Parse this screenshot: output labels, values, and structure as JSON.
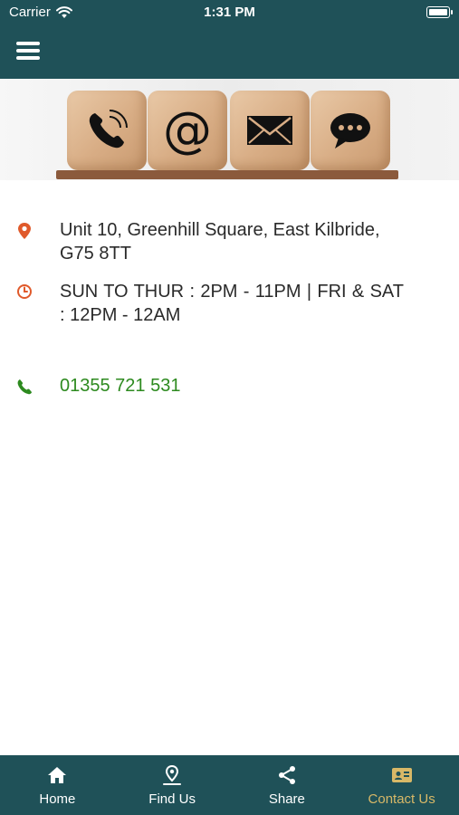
{
  "status_bar": {
    "carrier": "Carrier",
    "time": "1:31 PM",
    "battery_level": 1.0
  },
  "header": {
    "menu_icon": "hamburger-menu-icon",
    "background_color": "#1f5158"
  },
  "banner": {
    "cube_icons": [
      "phone-icon",
      "at-sign-icon",
      "envelope-icon",
      "chat-bubble-icon"
    ]
  },
  "contact": {
    "address": "Unit 10, Greenhill Square, East Kilbride, G75 8TT",
    "address_icon": "map-pin-icon",
    "hours": "SUN TO THUR : 2PM - 11PM | FRI & SAT : 12PM - 12AM",
    "hours_icon": "clock-icon",
    "phone": "01355 721 531",
    "phone_icon": "phone-icon"
  },
  "tabbar": {
    "items": [
      {
        "label": "Home",
        "icon": "home-icon",
        "active": false
      },
      {
        "label": "Find Us",
        "icon": "location-pin-icon",
        "active": false
      },
      {
        "label": "Share",
        "icon": "share-icon",
        "active": false
      },
      {
        "label": "Contact Us",
        "icon": "contact-card-icon",
        "active": true
      }
    ]
  },
  "colors": {
    "brand_teal": "#1f5158",
    "accent_orange": "#e05a2b",
    "phone_green": "#2d8a1f",
    "active_tab_gold": "#d8b867"
  }
}
